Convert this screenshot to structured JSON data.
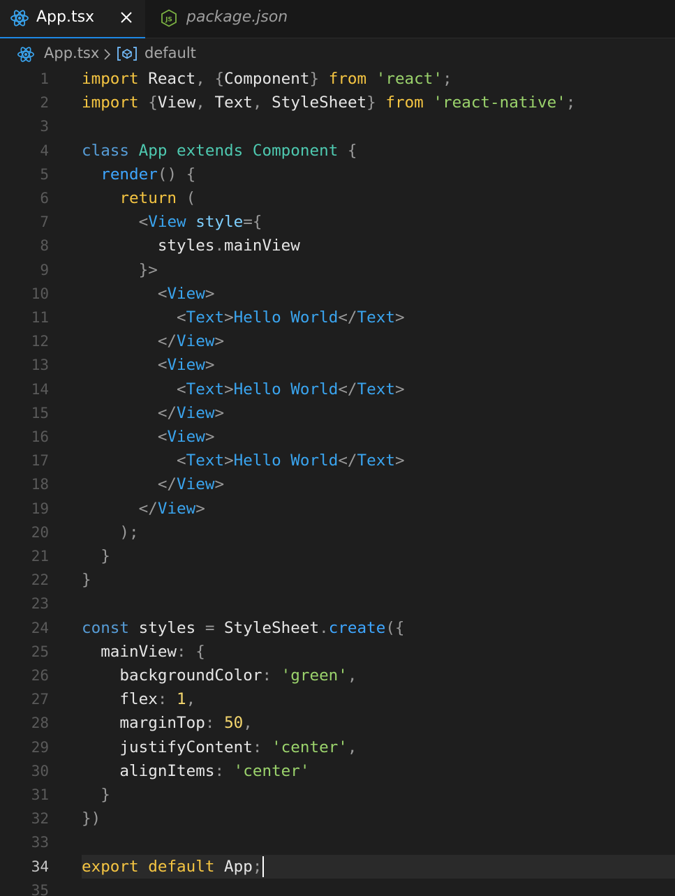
{
  "tabs": [
    {
      "label": "App.tsx",
      "icon": "react-icon",
      "active": true
    },
    {
      "label": "package.json",
      "icon": "nodejs-icon",
      "active": false
    }
  ],
  "breadcrumb": {
    "file": "App.tsx",
    "symbol": "default",
    "separator": ">"
  },
  "editor": {
    "current_line": 34,
    "lines": [
      {
        "n": "1",
        "tokens": [
          [
            "kw",
            "import"
          ],
          [
            "id",
            " React"
          ],
          [
            "pn",
            ", {"
          ],
          [
            "id",
            "Component"
          ],
          [
            "pn",
            "} "
          ],
          [
            "kw",
            "from"
          ],
          [
            "id",
            " "
          ],
          [
            "str",
            "'react'"
          ],
          [
            "pn",
            ";"
          ]
        ]
      },
      {
        "n": "2",
        "tokens": [
          [
            "kw",
            "import"
          ],
          [
            "pn",
            " {"
          ],
          [
            "id",
            "View"
          ],
          [
            "pn",
            ", "
          ],
          [
            "id",
            "Text"
          ],
          [
            "pn",
            ", "
          ],
          [
            "id",
            "StyleSheet"
          ],
          [
            "pn",
            "} "
          ],
          [
            "kw",
            "from"
          ],
          [
            "id",
            " "
          ],
          [
            "str",
            "'react-native'"
          ],
          [
            "pn",
            ";"
          ]
        ]
      },
      {
        "n": "3",
        "tokens": []
      },
      {
        "n": "4",
        "tokens": [
          [
            "kb",
            "class"
          ],
          [
            "id",
            " "
          ],
          [
            "ty",
            "App"
          ],
          [
            "id",
            " "
          ],
          [
            "ty",
            "extends"
          ],
          [
            "id",
            " "
          ],
          [
            "ty",
            "Component"
          ],
          [
            "pn",
            " {"
          ]
        ]
      },
      {
        "n": "5",
        "tokens": [
          [
            "id",
            "  "
          ],
          [
            "fn",
            "render"
          ],
          [
            "pn",
            "() {"
          ]
        ]
      },
      {
        "n": "6",
        "tokens": [
          [
            "id",
            "    "
          ],
          [
            "kw",
            "return"
          ],
          [
            "pn",
            " ("
          ]
        ]
      },
      {
        "n": "7",
        "tokens": [
          [
            "id",
            "      "
          ],
          [
            "pn",
            "<"
          ],
          [
            "tag",
            "View"
          ],
          [
            "id",
            " "
          ],
          [
            "attr",
            "style"
          ],
          [
            "pn",
            "={"
          ]
        ]
      },
      {
        "n": "8",
        "tokens": [
          [
            "id",
            "        styles"
          ],
          [
            "pn",
            "."
          ],
          [
            "id",
            "mainView"
          ]
        ]
      },
      {
        "n": "9",
        "tokens": [
          [
            "id",
            "      "
          ],
          [
            "pn",
            "}>"
          ]
        ]
      },
      {
        "n": "10",
        "tokens": [
          [
            "id",
            "        "
          ],
          [
            "pn",
            "<"
          ],
          [
            "tag",
            "View"
          ],
          [
            "pn",
            ">"
          ]
        ]
      },
      {
        "n": "11",
        "tokens": [
          [
            "id",
            "          "
          ],
          [
            "pn",
            "<"
          ],
          [
            "tag",
            "Text"
          ],
          [
            "pn",
            ">"
          ],
          [
            "jsxt",
            "Hello World"
          ],
          [
            "pn",
            "</"
          ],
          [
            "tag",
            "Text"
          ],
          [
            "pn",
            ">"
          ]
        ]
      },
      {
        "n": "12",
        "tokens": [
          [
            "id",
            "        "
          ],
          [
            "pn",
            "</"
          ],
          [
            "tag",
            "View"
          ],
          [
            "pn",
            ">"
          ]
        ]
      },
      {
        "n": "13",
        "tokens": [
          [
            "id",
            "        "
          ],
          [
            "pn",
            "<"
          ],
          [
            "tag",
            "View"
          ],
          [
            "pn",
            ">"
          ]
        ]
      },
      {
        "n": "14",
        "tokens": [
          [
            "id",
            "          "
          ],
          [
            "pn",
            "<"
          ],
          [
            "tag",
            "Text"
          ],
          [
            "pn",
            ">"
          ],
          [
            "jsxt",
            "Hello World"
          ],
          [
            "pn",
            "</"
          ],
          [
            "tag",
            "Text"
          ],
          [
            "pn",
            ">"
          ]
        ]
      },
      {
        "n": "15",
        "tokens": [
          [
            "id",
            "        "
          ],
          [
            "pn",
            "</"
          ],
          [
            "tag",
            "View"
          ],
          [
            "pn",
            ">"
          ]
        ]
      },
      {
        "n": "16",
        "tokens": [
          [
            "id",
            "        "
          ],
          [
            "pn",
            "<"
          ],
          [
            "tag",
            "View"
          ],
          [
            "pn",
            ">"
          ]
        ]
      },
      {
        "n": "17",
        "tokens": [
          [
            "id",
            "          "
          ],
          [
            "pn",
            "<"
          ],
          [
            "tag",
            "Text"
          ],
          [
            "pn",
            ">"
          ],
          [
            "jsxt",
            "Hello World"
          ],
          [
            "pn",
            "</"
          ],
          [
            "tag",
            "Text"
          ],
          [
            "pn",
            ">"
          ]
        ]
      },
      {
        "n": "18",
        "tokens": [
          [
            "id",
            "        "
          ],
          [
            "pn",
            "</"
          ],
          [
            "tag",
            "View"
          ],
          [
            "pn",
            ">"
          ]
        ]
      },
      {
        "n": "19",
        "tokens": [
          [
            "id",
            "      "
          ],
          [
            "pn",
            "</"
          ],
          [
            "tag",
            "View"
          ],
          [
            "pn",
            ">"
          ]
        ]
      },
      {
        "n": "20",
        "tokens": [
          [
            "id",
            "    "
          ],
          [
            "pn",
            ");"
          ]
        ]
      },
      {
        "n": "21",
        "tokens": [
          [
            "id",
            "  "
          ],
          [
            "pn",
            "}"
          ]
        ]
      },
      {
        "n": "22",
        "tokens": [
          [
            "pn",
            "}"
          ]
        ]
      },
      {
        "n": "23",
        "tokens": []
      },
      {
        "n": "24",
        "tokens": [
          [
            "kb",
            "const"
          ],
          [
            "id",
            " styles "
          ],
          [
            "pn",
            "="
          ],
          [
            "id",
            " StyleSheet"
          ],
          [
            "pn",
            "."
          ],
          [
            "fn",
            "create"
          ],
          [
            "pn",
            "({"
          ]
        ]
      },
      {
        "n": "25",
        "tokens": [
          [
            "id",
            "  mainView"
          ],
          [
            "pn",
            ": {"
          ]
        ]
      },
      {
        "n": "26",
        "tokens": [
          [
            "id",
            "    backgroundColor"
          ],
          [
            "pn",
            ": "
          ],
          [
            "str",
            "'green'"
          ],
          [
            "pn",
            ","
          ]
        ]
      },
      {
        "n": "27",
        "tokens": [
          [
            "id",
            "    flex"
          ],
          [
            "pn",
            ": "
          ],
          [
            "num",
            "1"
          ],
          [
            "pn",
            ","
          ]
        ]
      },
      {
        "n": "28",
        "tokens": [
          [
            "id",
            "    marginTop"
          ],
          [
            "pn",
            ": "
          ],
          [
            "num",
            "50"
          ],
          [
            "pn",
            ","
          ]
        ]
      },
      {
        "n": "29",
        "tokens": [
          [
            "id",
            "    justifyContent"
          ],
          [
            "pn",
            ": "
          ],
          [
            "str",
            "'center'"
          ],
          [
            "pn",
            ","
          ]
        ]
      },
      {
        "n": "30",
        "tokens": [
          [
            "id",
            "    alignItems"
          ],
          [
            "pn",
            ": "
          ],
          [
            "str",
            "'center'"
          ]
        ]
      },
      {
        "n": "31",
        "tokens": [
          [
            "id",
            "  "
          ],
          [
            "pn",
            "}"
          ]
        ]
      },
      {
        "n": "32",
        "tokens": [
          [
            "pn",
            "})"
          ]
        ]
      },
      {
        "n": "33",
        "tokens": []
      },
      {
        "n": "34",
        "tokens": [
          [
            "kw",
            "export"
          ],
          [
            "id",
            " "
          ],
          [
            "kw",
            "default"
          ],
          [
            "id",
            " App"
          ],
          [
            "pn",
            ";"
          ]
        ]
      },
      {
        "n": "35",
        "tokens": []
      }
    ]
  }
}
